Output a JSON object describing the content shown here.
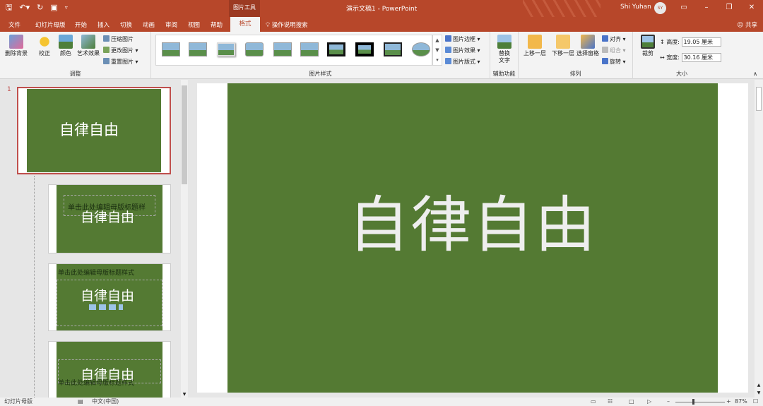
{
  "window": {
    "doc_title": "演示文稿1 - PowerPoint",
    "context_tab": "图片工具",
    "user": "Shi Yuhan",
    "avatar": "SY"
  },
  "colors": {
    "accent": "#b7472a",
    "slide_green": "#547a33"
  },
  "tabs": [
    "文件",
    "幻灯片母版",
    "开始",
    "插入",
    "切换",
    "动画",
    "审阅",
    "视图",
    "帮助",
    "格式"
  ],
  "tellme": "操作说明搜索",
  "share": "共享",
  "ribbon": {
    "adjust": {
      "label": "调整",
      "remove_bg": "删除背景",
      "correct": "校正",
      "color": "颜色",
      "artistic": "艺术效果",
      "compress": "压缩图片",
      "change": "更改图片",
      "reset": "重置图片"
    },
    "styles": {
      "label": "图片样式",
      "border": "图片边框",
      "effects": "图片效果",
      "layout": "图片版式"
    },
    "accessibility": {
      "label": "辅助功能",
      "alt_text": "替换文字"
    },
    "arrange": {
      "label": "排列",
      "forward": "上移一层",
      "backward": "下移一层",
      "pane": "选择窗格",
      "align": "对齐",
      "group": "组合",
      "rotate": "旋转"
    },
    "size": {
      "label": "大小",
      "crop": "裁剪",
      "height_label": "高度:",
      "height_value": "19.05 厘米",
      "width_label": "宽度:",
      "width_value": "30.16 厘米"
    }
  },
  "thumbnails": {
    "master_number": "1",
    "slide_text": "自律自由",
    "layout1_title": "单击此处编辑母版标题样",
    "layout2_title": "单击此处编辑母版标题样式",
    "layout4_title": "单击此处编辑母版标题样式"
  },
  "slide": {
    "text": "自律自由"
  },
  "status": {
    "view": "幻灯片母版",
    "lang": "中文(中国)",
    "zoom": "87%"
  }
}
